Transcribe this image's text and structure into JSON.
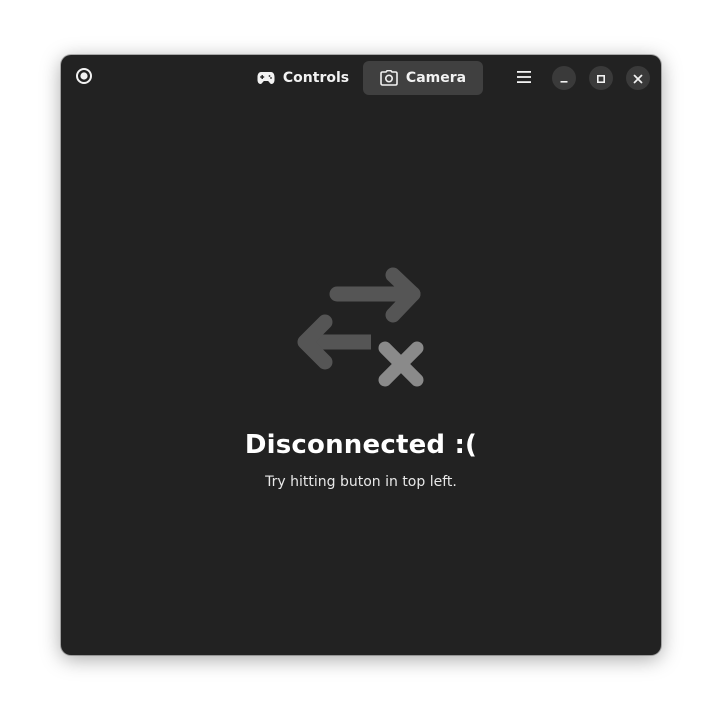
{
  "window": {
    "background": "#222222"
  },
  "headerbar": {
    "start_button_icon": "record-circle-icon",
    "tabs": [
      {
        "label": "Controls",
        "icon": "gamepad-icon",
        "active": false
      },
      {
        "label": "Camera",
        "icon": "camera-icon",
        "active": true
      }
    ],
    "menu_icon": "hamburger-menu-icon",
    "window_controls": [
      "minimize-icon",
      "maximize-icon",
      "close-icon"
    ]
  },
  "status": {
    "icon": "network-disconnected-icon",
    "title": "Disconnected :(",
    "description": "Try hitting buton in top left."
  },
  "colors": {
    "accent_tab": "#404040",
    "icon_dark_gray": "#555555",
    "icon_light_gray": "#8a8a8a",
    "text": "#ffffff"
  }
}
